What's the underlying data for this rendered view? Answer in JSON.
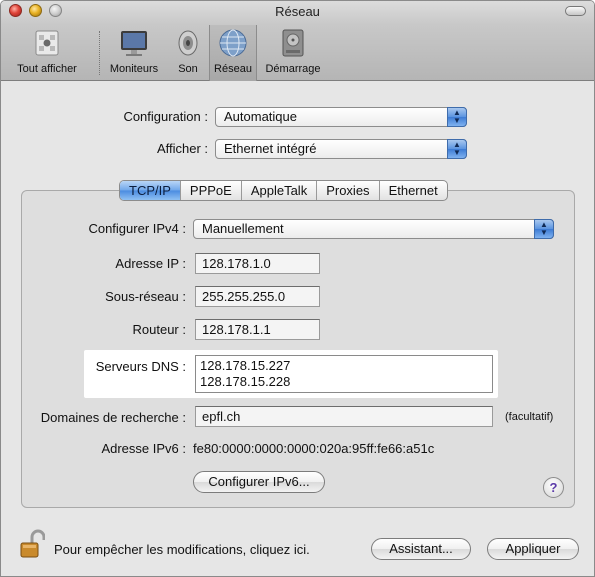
{
  "window": {
    "title": "Réseau"
  },
  "toolbar": {
    "items": [
      {
        "label": "Tout afficher",
        "icon": "apple-grid-icon"
      },
      {
        "label": "Moniteurs",
        "icon": "monitor-icon"
      },
      {
        "label": "Son",
        "icon": "speaker-icon"
      },
      {
        "label": "Réseau",
        "icon": "network-globe-icon"
      },
      {
        "label": "Démarrage",
        "icon": "startup-disk-icon"
      }
    ],
    "selected": "Réseau"
  },
  "top": {
    "configuration_label": "Configuration :",
    "configuration_value": "Automatique",
    "show_label": "Afficher :",
    "show_value": "Ethernet intégré"
  },
  "tabs": {
    "items": [
      "TCP/IP",
      "PPPoE",
      "AppleTalk",
      "Proxies",
      "Ethernet"
    ],
    "active": "TCP/IP"
  },
  "tcpip": {
    "configure_label": "Configurer IPv4 :",
    "configure_value": "Manuellement",
    "ip_label": "Adresse IP :",
    "ip_value": "128.178.1.0",
    "subnet_label": "Sous-réseau :",
    "subnet_value": "255.255.255.0",
    "router_label": "Routeur :",
    "router_value": "128.178.1.1",
    "dns_label": "Serveurs DNS :",
    "dns_line1": "128.178.15.227",
    "dns_line2": "128.178.15.228",
    "search_label": "Domaines de recherche :",
    "search_value": "epfl.ch",
    "optional_note": "(facultatif)",
    "ipv6_label": "Adresse IPv6 :",
    "ipv6_value": "fe80:0000:0000:0000:020a:95ff:fe66:a51c",
    "configure_ipv6_button": "Configurer IPv6..."
  },
  "help_label": "?",
  "footer": {
    "lock_text": "Pour empêcher les modifications, cliquez ici.",
    "assistant_button": "Assistant...",
    "apply_button": "Appliquer"
  },
  "colors": {
    "accent_blue": "#5a93e0",
    "highlight": "#ffffff",
    "help_purple": "#5b3aa8"
  }
}
